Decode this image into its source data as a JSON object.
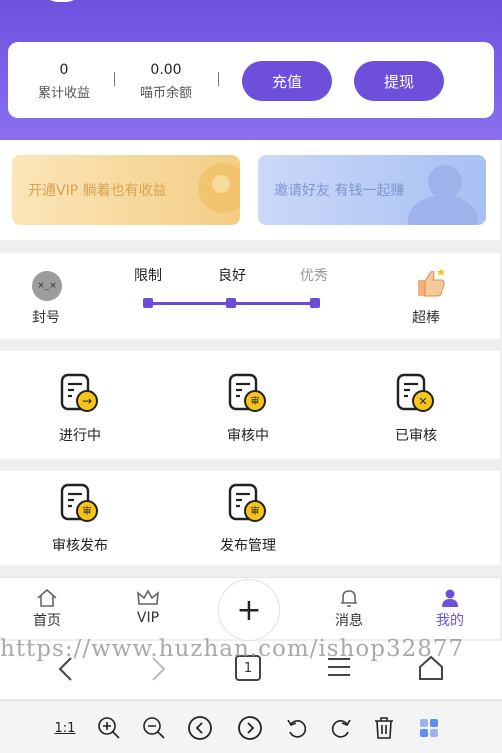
{
  "wallet": {
    "total_earnings_value": "0",
    "total_earnings_label": "累计收益",
    "coin_balance_value": "0.00",
    "coin_balance_label": "喵币余额",
    "recharge_label": "充值",
    "withdraw_label": "提现"
  },
  "banners": {
    "vip_text": "开通VIP 躺着也有收益",
    "invite_text": "邀请好友 有钱一起赚"
  },
  "level": {
    "left_label": "封号",
    "steps": [
      "限制",
      "良好",
      "优秀"
    ],
    "right_label": "超棒"
  },
  "tasks": [
    {
      "label": "进行中",
      "badge": "→"
    },
    {
      "label": "审核中",
      "badge": "审"
    },
    {
      "label": "已审核",
      "badge": "✕"
    },
    {
      "label": "审核发布",
      "badge": "审"
    },
    {
      "label": "发布管理",
      "badge": "审"
    }
  ],
  "tabbar": {
    "home": "首页",
    "vip": "VIP",
    "plus": "+",
    "messages": "消息",
    "mine": "我的",
    "active_color": "#6e4fdb"
  },
  "watermark": "https://www.huzhan.com/ishop32877",
  "browser": {
    "tab_count": "1",
    "zoom_label": "1:1"
  },
  "colors": {
    "accent": "#6e4fdb",
    "header_gradient_start": "#6d52de",
    "icon_yellow": "#f7c41a"
  }
}
